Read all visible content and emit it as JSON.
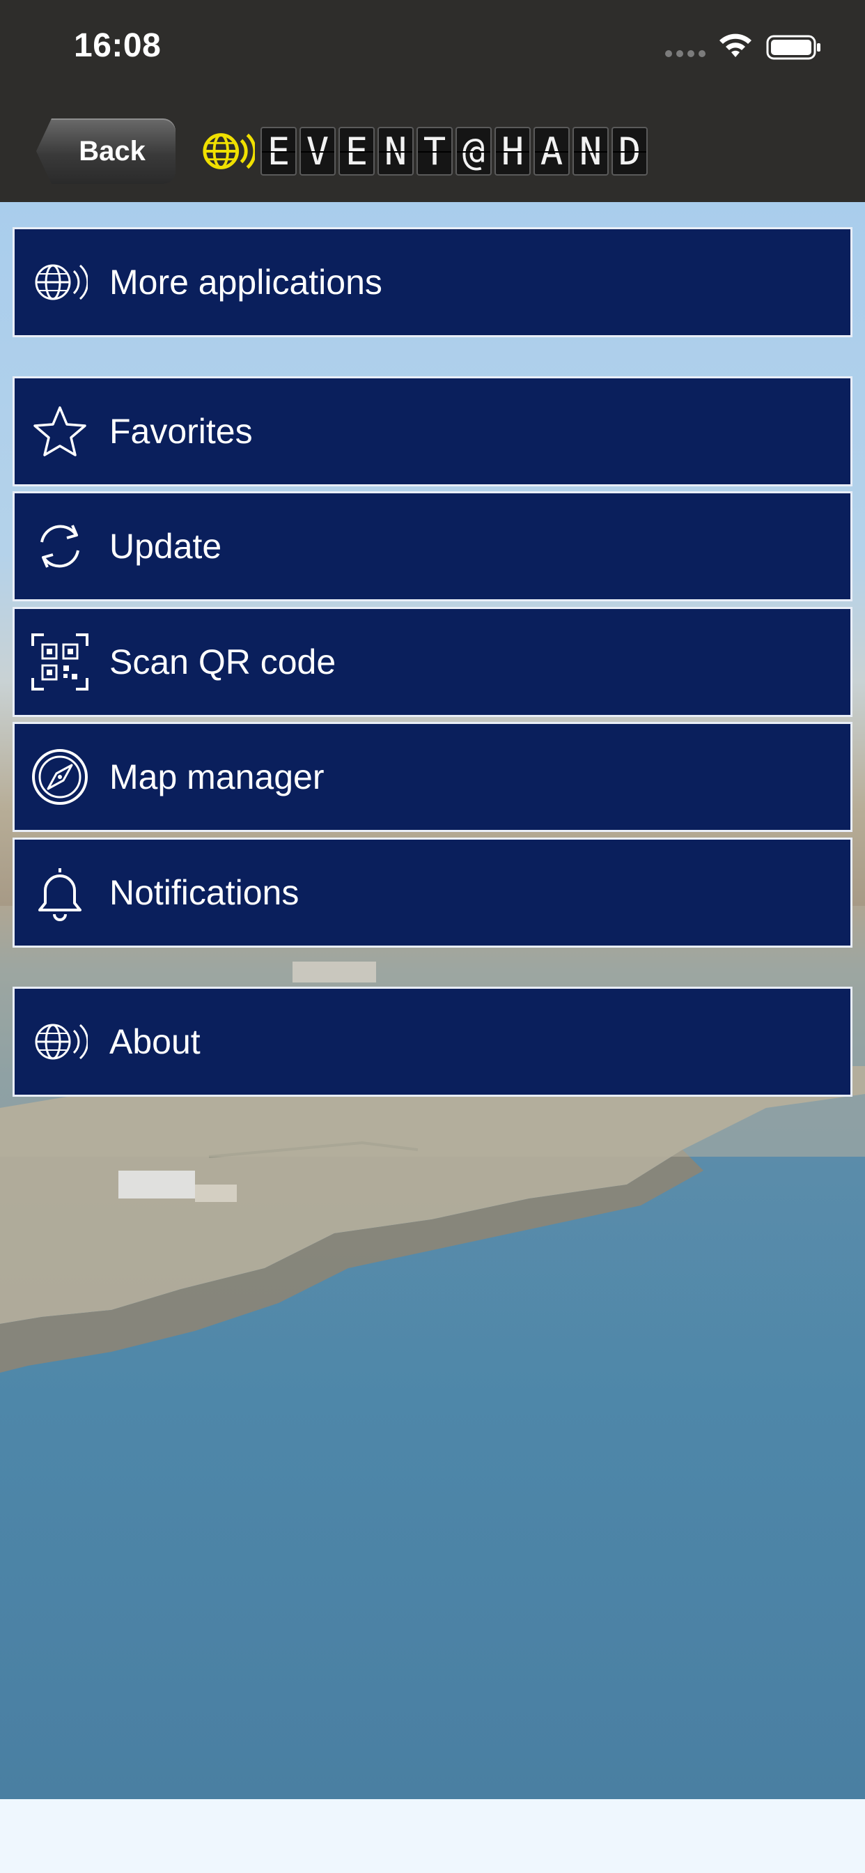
{
  "status_bar": {
    "time": "16:08"
  },
  "nav": {
    "back_label": "Back",
    "logo_letters": [
      "E",
      "V",
      "E",
      "N",
      "T",
      "@",
      "H",
      "A",
      "N",
      "D"
    ]
  },
  "menu": {
    "more_applications": "More applications",
    "favorites": "Favorites",
    "update": "Update",
    "scan_qr": "Scan QR code",
    "map_manager": "Map manager",
    "notifications": "Notifications",
    "about": "About"
  },
  "colors": {
    "menu_bg": "#0a1f5c",
    "topbar_bg": "#2e2d2b",
    "logo_accent": "#f0e000"
  }
}
